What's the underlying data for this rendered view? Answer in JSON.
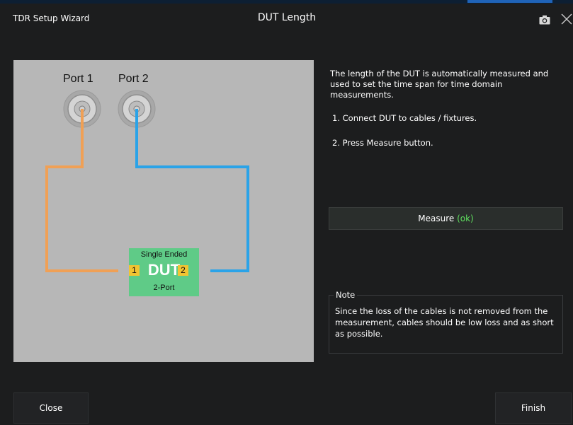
{
  "window": {
    "app_title": "TDR Setup Wizard",
    "page_title": "DUT Length"
  },
  "toolbar": {
    "camera_icon": "camera-icon",
    "close_icon": "close-x-icon"
  },
  "diagram": {
    "port1_label": "Port 1",
    "port2_label": "Port 2",
    "dut_type": "Single Ended",
    "dut_label": "DUT",
    "dut_ports": "2-Port",
    "dut_port1": "1",
    "dut_port2": "2",
    "colors": {
      "background": "#b7b7b7",
      "cable1": "#f0a055",
      "cable2": "#2aa3e8",
      "dut_fill": "#5fcb87",
      "dut_port": "#f2c431"
    }
  },
  "instructions": {
    "description": "The length of the DUT is automatically measured and used to set the time span for time domain measurements.",
    "step1": "1. Connect DUT to cables / fixtures.",
    "step2": "2. Press Measure button."
  },
  "measure": {
    "label": "Measure",
    "status": "(ok)",
    "status_color": "#5fe05f"
  },
  "note": {
    "title": "Note",
    "text": "Since the loss of the cables is not removed from the measurement, cables should be low loss and as short as possible."
  },
  "footer": {
    "close_label": "Close",
    "finish_label": "Finish"
  }
}
